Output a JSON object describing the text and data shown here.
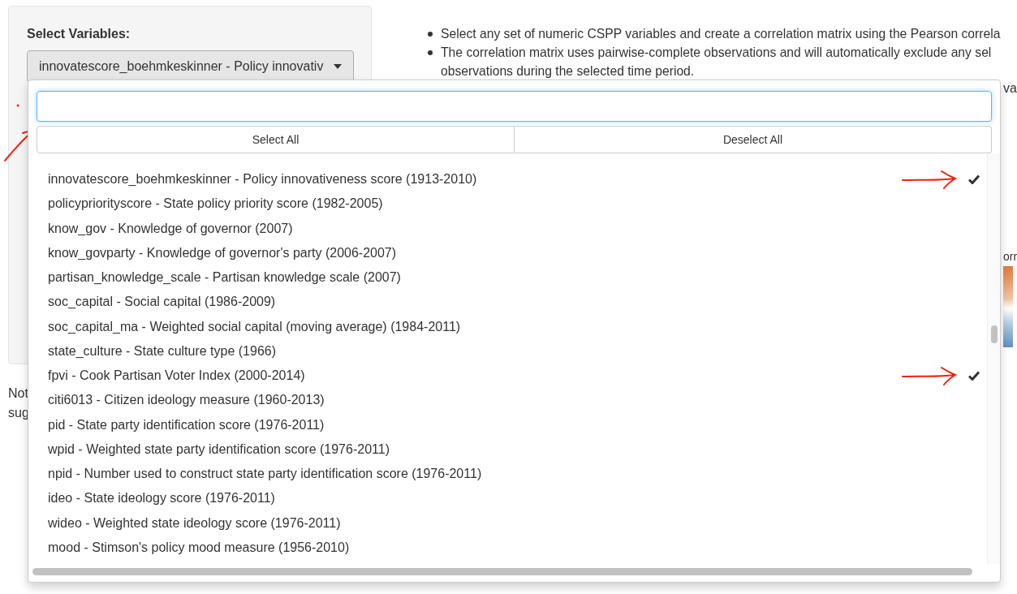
{
  "sidebar": {
    "label": "Select Variables:",
    "dropdown_value": "innovatescore_boehmkeskinner - Policy innovativ"
  },
  "info": {
    "bullets": [
      {
        "lines": [
          "Select any set of numeric CSPP variables and create a correlation matrix using the Pearson correla"
        ]
      },
      {
        "lines": [
          "The correlation matrix uses pairwise-complete observations and will automatically exclude any sel",
          "observations during the selected time period."
        ]
      }
    ],
    "fragment": "va"
  },
  "note_fragments": [
    "Not",
    "sug"
  ],
  "legend": {
    "title_fragment": "orr"
  },
  "dropdown": {
    "buttons": [
      "Select All",
      "Deselect All"
    ],
    "options": [
      {
        "label": "innovatescore_boehmkeskinner - Policy innovativeness score (1913-2010)",
        "selected": true
      },
      {
        "label": "policypriorityscore - State policy priority score (1982-2005)",
        "selected": false
      },
      {
        "label": "know_gov - Knowledge of governor (2007)",
        "selected": false
      },
      {
        "label": "know_govparty - Knowledge of governor's party (2006-2007)",
        "selected": false
      },
      {
        "label": "partisan_knowledge_scale - Partisan knowledge scale (2007)",
        "selected": false
      },
      {
        "label": "soc_capital - Social capital (1986-2009)",
        "selected": false
      },
      {
        "label": "soc_capital_ma - Weighted social capital (moving average) (1984-2011)",
        "selected": false
      },
      {
        "label": "state_culture - State culture type (1966)",
        "selected": false
      },
      {
        "label": "fpvi - Cook Partisan Voter Index (2000-2014)",
        "selected": true
      },
      {
        "label": "citi6013 - Citizen ideology measure (1960-2013)",
        "selected": false
      },
      {
        "label": "pid - State party identification score (1976-2011)",
        "selected": false
      },
      {
        "label": "wpid - Weighted state party identification score (1976-2011)",
        "selected": false
      },
      {
        "label": "npid - Number used to construct state party identification score (1976-2011)",
        "selected": false
      },
      {
        "label": "ideo - State ideology score (1976-2011)",
        "selected": false
      },
      {
        "label": "wideo - Weighted state ideology score (1976-2011)",
        "selected": false
      },
      {
        "label": "mood - Stimson's policy mood measure (1956-2010)",
        "selected": false
      }
    ]
  }
}
